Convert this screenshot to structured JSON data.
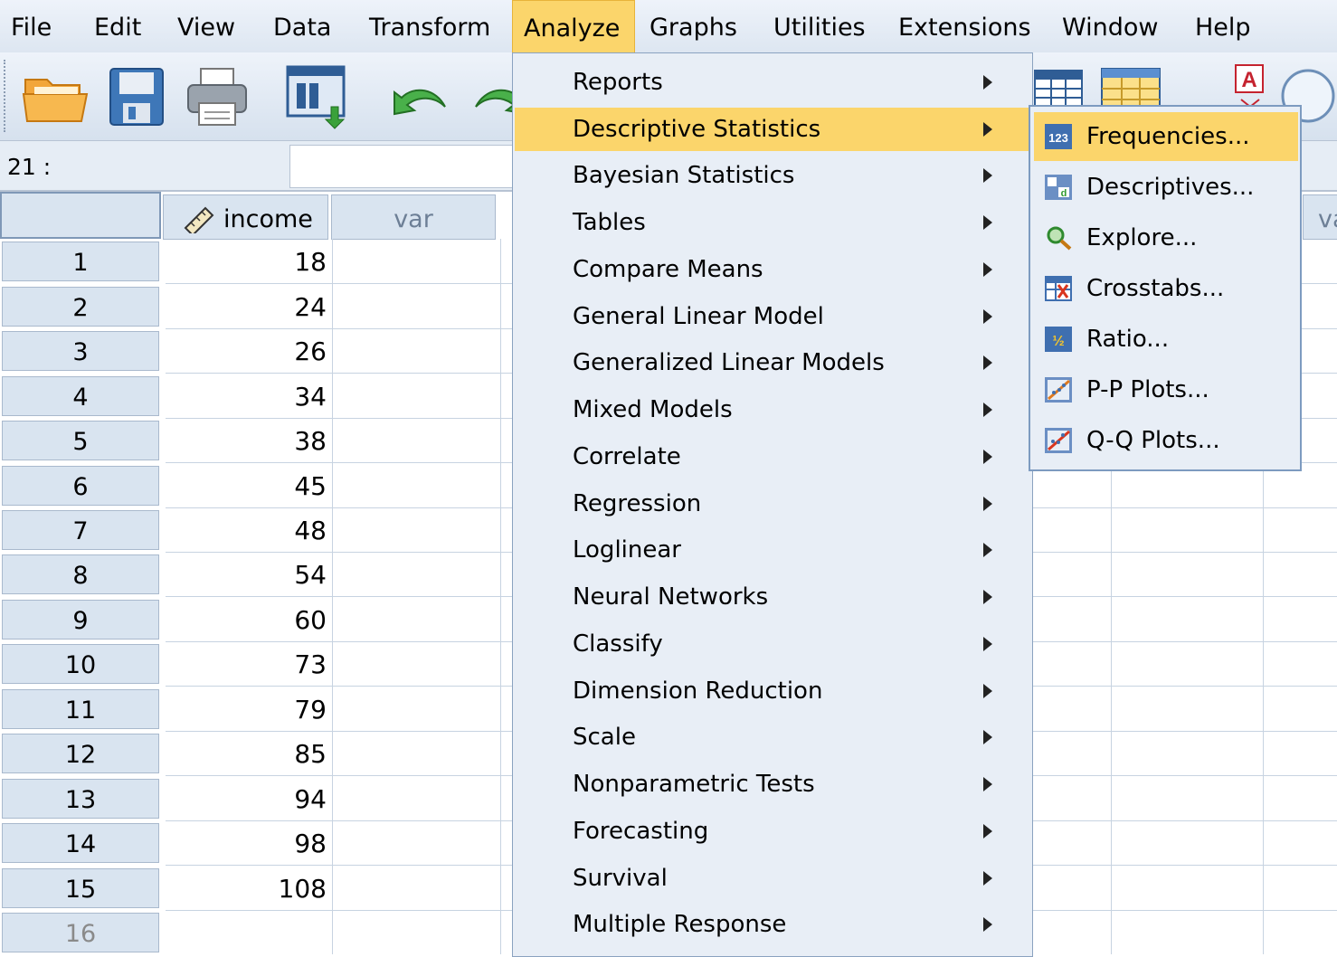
{
  "menubar": {
    "items": [
      {
        "label": "File"
      },
      {
        "label": "Edit"
      },
      {
        "label": "View"
      },
      {
        "label": "Data"
      },
      {
        "label": "Transform"
      },
      {
        "label": "Analyze"
      },
      {
        "label": "Graphs"
      },
      {
        "label": "Utilities"
      },
      {
        "label": "Extensions"
      },
      {
        "label": "Window"
      },
      {
        "label": "Help"
      }
    ],
    "active": "Analyze"
  },
  "toolbar": {
    "icons": [
      "open-folder-icon",
      "save-icon",
      "print-icon",
      "dialog-recall-icon",
      "undo-icon",
      "redo-icon",
      "variables-icon",
      "value-labels-icon",
      "text-icon",
      "circle-icon"
    ]
  },
  "cellref": {
    "label": "21 :",
    "value": ""
  },
  "grid": {
    "columns": [
      {
        "name": "income",
        "icon": "ruler-pencil-icon"
      },
      {
        "name": "var"
      }
    ],
    "extra_col_partial": "va",
    "rows": [
      {
        "n": "1",
        "income": "18"
      },
      {
        "n": "2",
        "income": "24"
      },
      {
        "n": "3",
        "income": "26"
      },
      {
        "n": "4",
        "income": "34"
      },
      {
        "n": "5",
        "income": "38"
      },
      {
        "n": "6",
        "income": "45"
      },
      {
        "n": "7",
        "income": "48"
      },
      {
        "n": "8",
        "income": "54"
      },
      {
        "n": "9",
        "income": "60"
      },
      {
        "n": "10",
        "income": "73"
      },
      {
        "n": "11",
        "income": "79"
      },
      {
        "n": "12",
        "income": "85"
      },
      {
        "n": "13",
        "income": "94"
      },
      {
        "n": "14",
        "income": "98"
      },
      {
        "n": "15",
        "income": "108"
      },
      {
        "n": "16",
        "income": ""
      }
    ]
  },
  "analyze_menu": {
    "items": [
      {
        "label": "Reports"
      },
      {
        "label": "Descriptive Statistics"
      },
      {
        "label": "Bayesian Statistics"
      },
      {
        "label": "Tables"
      },
      {
        "label": "Compare Means"
      },
      {
        "label": "General Linear Model"
      },
      {
        "label": "Generalized Linear Models"
      },
      {
        "label": "Mixed Models"
      },
      {
        "label": "Correlate"
      },
      {
        "label": "Regression"
      },
      {
        "label": "Loglinear"
      },
      {
        "label": "Neural Networks"
      },
      {
        "label": "Classify"
      },
      {
        "label": "Dimension Reduction"
      },
      {
        "label": "Scale"
      },
      {
        "label": "Nonparametric Tests"
      },
      {
        "label": "Forecasting"
      },
      {
        "label": "Survival"
      },
      {
        "label": "Multiple Response"
      }
    ],
    "highlighted": "Descriptive Statistics"
  },
  "descriptive_submenu": {
    "items": [
      {
        "label": "Frequencies...",
        "icon": "frequencies-123-icon"
      },
      {
        "label": "Descriptives...",
        "icon": "descriptives-icon"
      },
      {
        "label": "Explore...",
        "icon": "explore-magnifier-icon"
      },
      {
        "label": "Crosstabs...",
        "icon": "crosstabs-icon"
      },
      {
        "label": "Ratio...",
        "icon": "ratio-half-icon"
      },
      {
        "label": "P-P Plots...",
        "icon": "pp-plot-icon"
      },
      {
        "label": "Q-Q Plots...",
        "icon": "qq-plot-icon"
      }
    ],
    "highlighted": "Frequencies..."
  },
  "colors": {
    "menu_highlight": "#fbd56b",
    "menu_bg": "#e8eef6",
    "header_bg": "#d9e4f0",
    "grid_line": "#c7d3e1"
  }
}
